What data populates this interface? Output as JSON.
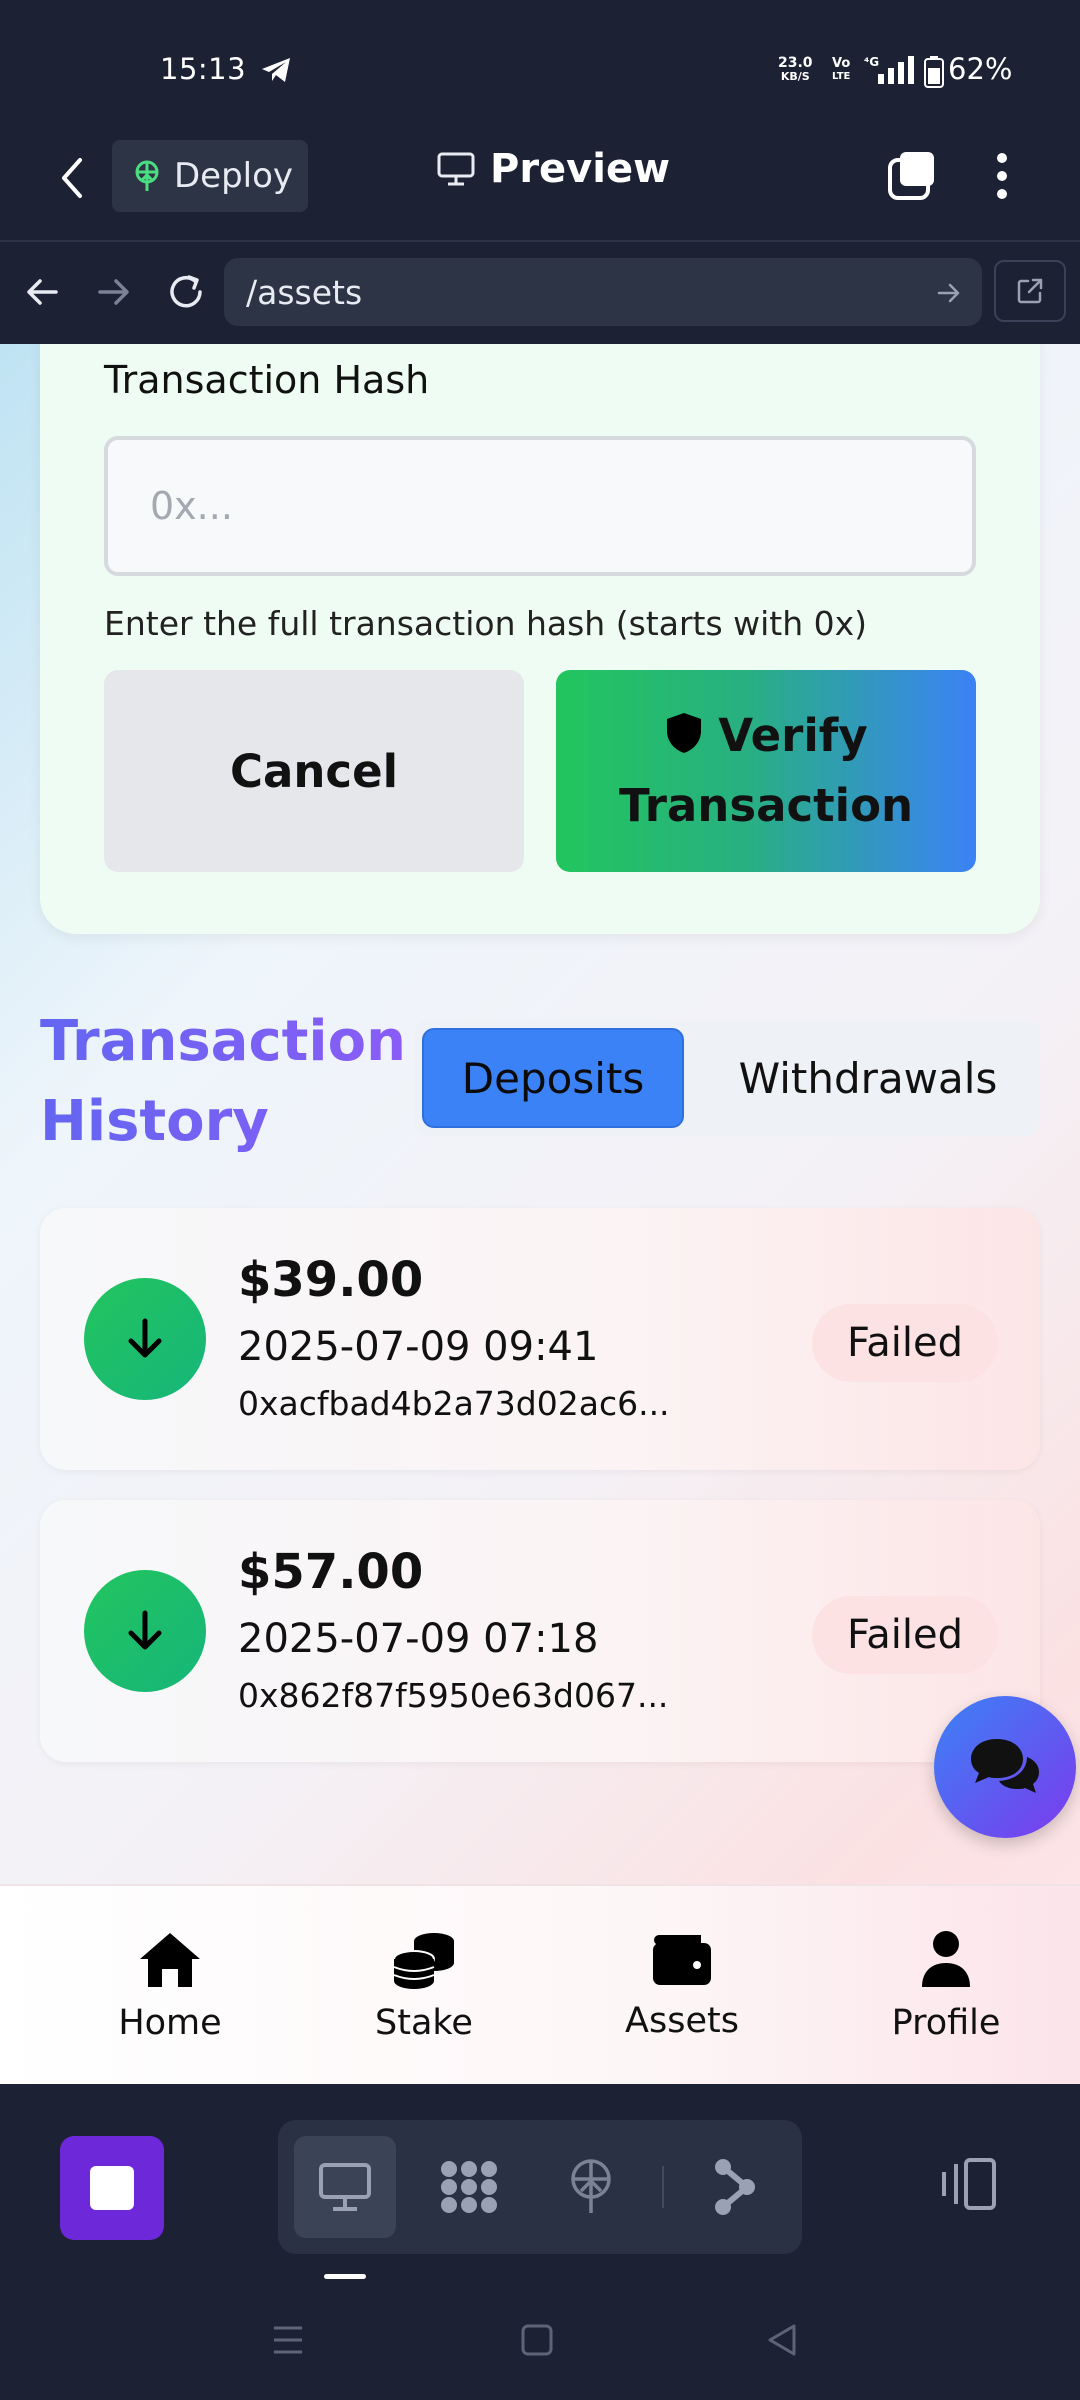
{
  "status_bar": {
    "time": "15:13",
    "net_speed_value": "23.0",
    "net_speed_unit": "KB/S",
    "volte_top": "Vo",
    "volte_bottom": "LTE",
    "network": "4G",
    "battery": "62%"
  },
  "app_header": {
    "deploy_label": "Deploy",
    "preview_label": "Preview"
  },
  "browser": {
    "url": "/assets"
  },
  "verify_form": {
    "hash_label": "Transaction Hash",
    "hash_placeholder": "0x...",
    "hash_help": "Enter the full transaction hash (starts with 0x)",
    "cancel_label": "Cancel",
    "verify_label_line1": "Verify",
    "verify_label_line2": "Transaction"
  },
  "history": {
    "title_line1": "Transaction",
    "title_line2": "History",
    "tabs": [
      {
        "label": "Deposits",
        "active": true
      },
      {
        "label": "Withdrawals",
        "active": false
      }
    ],
    "transactions": [
      {
        "amount": "$39.00",
        "datetime": "2025-07-09 09:41",
        "hash": "0xacfbad4b2a73d02ac6...",
        "status": "Failed",
        "icon": "arrow-down-icon"
      },
      {
        "amount": "$57.00",
        "datetime": "2025-07-09 07:18",
        "hash": "0x862f87f5950e63d067...",
        "status": "Failed",
        "icon": "arrow-down-icon"
      }
    ]
  },
  "bottom_nav": {
    "items": [
      {
        "label": "Home",
        "icon": "home-icon"
      },
      {
        "label": "Stake",
        "icon": "coins-icon"
      },
      {
        "label": "Assets",
        "icon": "wallet-icon"
      },
      {
        "label": "Profile",
        "icon": "user-icon"
      }
    ]
  },
  "colors": {
    "accent_blue": "#3b82f6",
    "success_green": "#22c55e",
    "title_purple": "#6366f1",
    "failed_badge": "#fde2e3",
    "dark_chrome": "#1c2233"
  }
}
